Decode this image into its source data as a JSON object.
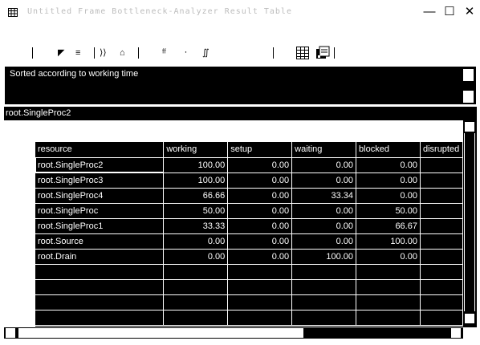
{
  "window": {
    "title": "Untitled Frame Bottleneck-Analyzer Result Table",
    "minimize_label": "—",
    "maximize_label": "☐",
    "close_label": "✕"
  },
  "toolbar": {
    "glyphs": [
      "◤",
      "≡",
      "⟩⟩",
      "⌂",
      "ᶠᶠ",
      "⸱",
      "∬"
    ]
  },
  "message": "Sorted according to working time",
  "path": "root.SingleProc2",
  "table": {
    "columns": [
      "resource",
      "working",
      "setup",
      "waiting",
      "blocked",
      "disrupted"
    ],
    "rows": [
      [
        "root.SingleProc2",
        "100.00",
        "0.00",
        "0.00",
        "0.00",
        ""
      ],
      [
        "root.SingleProc3",
        "100.00",
        "0.00",
        "0.00",
        "0.00",
        ""
      ],
      [
        "root.SingleProc4",
        "66.66",
        "0.00",
        "33.34",
        "0.00",
        ""
      ],
      [
        "root.SingleProc",
        "50.00",
        "0.00",
        "0.00",
        "50.00",
        ""
      ],
      [
        "root.SingleProc1",
        "33.33",
        "0.00",
        "0.00",
        "66.67",
        ""
      ],
      [
        "root.Source",
        "0.00",
        "0.00",
        "0.00",
        "100.00",
        ""
      ],
      [
        "root.Drain",
        "0.00",
        "0.00",
        "100.00",
        "0.00",
        ""
      ],
      [
        "",
        "",
        "",
        "",
        "",
        ""
      ],
      [
        "",
        "",
        "",
        "",
        "",
        ""
      ],
      [
        "",
        "",
        "",
        "",
        "",
        ""
      ],
      [
        "",
        "",
        "",
        "",
        "",
        ""
      ]
    ]
  },
  "colors": {
    "background": "#000000",
    "text": "#ffffff",
    "chrome": "#ffffff"
  }
}
